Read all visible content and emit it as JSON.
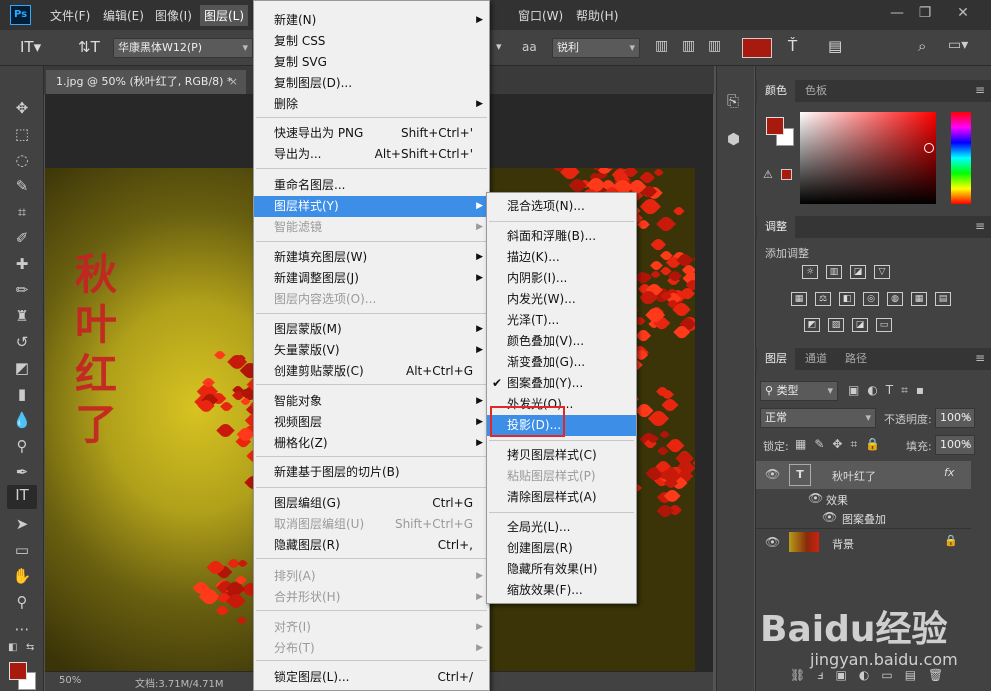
{
  "app": {
    "logo": "Ps"
  },
  "menubar": {
    "items": [
      "文件(F)",
      "编辑(E)",
      "图像(I)",
      "图层(L)",
      "窗口(W)",
      "帮助(H)"
    ]
  },
  "options": {
    "font_family": "华康黑体W12(P)",
    "aa_label": "aa",
    "anti_alias": "锐利",
    "text_color": "#a81a0e"
  },
  "document": {
    "tab_title": "1.jpg @ 50% (秋叶红了, RGB/8) *",
    "zoom": "50%",
    "doc_size": "文档:3.71M/4.71M",
    "text_layer_content": "秋叶红了"
  },
  "layer_menu": {
    "items": [
      {
        "label": "新建(N)",
        "shortcut": "",
        "arrow": true,
        "disabled": false
      },
      {
        "label": "复制 CSS",
        "shortcut": "",
        "arrow": false,
        "disabled": false
      },
      {
        "label": "复制 SVG",
        "shortcut": "",
        "arrow": false,
        "disabled": false
      },
      {
        "label": "复制图层(D)...",
        "shortcut": "",
        "arrow": false,
        "disabled": false
      },
      {
        "label": "删除",
        "shortcut": "",
        "arrow": true,
        "disabled": false
      },
      {
        "label": "快速导出为 PNG",
        "shortcut": "Shift+Ctrl+'",
        "arrow": false,
        "disabled": false
      },
      {
        "label": "导出为...",
        "shortcut": "Alt+Shift+Ctrl+'",
        "arrow": false,
        "disabled": false
      },
      {
        "label": "重命名图层...",
        "shortcut": "",
        "arrow": false,
        "disabled": false
      },
      {
        "label": "图层样式(Y)",
        "shortcut": "",
        "arrow": true,
        "disabled": false
      },
      {
        "label": "智能滤镜",
        "shortcut": "",
        "arrow": true,
        "disabled": true
      },
      {
        "label": "新建填充图层(W)",
        "shortcut": "",
        "arrow": true,
        "disabled": false
      },
      {
        "label": "新建调整图层(J)",
        "shortcut": "",
        "arrow": true,
        "disabled": false
      },
      {
        "label": "图层内容选项(O)...",
        "shortcut": "",
        "arrow": false,
        "disabled": true
      },
      {
        "label": "图层蒙版(M)",
        "shortcut": "",
        "arrow": true,
        "disabled": false
      },
      {
        "label": "矢量蒙版(V)",
        "shortcut": "",
        "arrow": true,
        "disabled": false
      },
      {
        "label": "创建剪贴蒙版(C)",
        "shortcut": "Alt+Ctrl+G",
        "arrow": false,
        "disabled": false
      },
      {
        "label": "智能对象",
        "shortcut": "",
        "arrow": true,
        "disabled": false
      },
      {
        "label": "视频图层",
        "shortcut": "",
        "arrow": true,
        "disabled": false
      },
      {
        "label": "栅格化(Z)",
        "shortcut": "",
        "arrow": true,
        "disabled": false
      },
      {
        "label": "新建基于图层的切片(B)",
        "shortcut": "",
        "arrow": false,
        "disabled": false
      },
      {
        "label": "图层编组(G)",
        "shortcut": "Ctrl+G",
        "arrow": false,
        "disabled": false
      },
      {
        "label": "取消图层编组(U)",
        "shortcut": "Shift+Ctrl+G",
        "arrow": false,
        "disabled": true
      },
      {
        "label": "隐藏图层(R)",
        "shortcut": "Ctrl+,",
        "arrow": false,
        "disabled": false
      },
      {
        "label": "排列(A)",
        "shortcut": "",
        "arrow": true,
        "disabled": true
      },
      {
        "label": "合并形状(H)",
        "shortcut": "",
        "arrow": true,
        "disabled": true
      },
      {
        "label": "对齐(I)",
        "shortcut": "",
        "arrow": true,
        "disabled": true
      },
      {
        "label": "分布(T)",
        "shortcut": "",
        "arrow": true,
        "disabled": true
      },
      {
        "label": "锁定图层(L)...",
        "shortcut": "Ctrl+/",
        "arrow": false,
        "disabled": false
      }
    ]
  },
  "style_submenu": {
    "items": [
      {
        "label": "混合选项(N)...",
        "checked": false,
        "disabled": false
      },
      {
        "label": "斜面和浮雕(B)...",
        "checked": false,
        "disabled": false
      },
      {
        "label": "描边(K)...",
        "checked": false,
        "disabled": false
      },
      {
        "label": "内阴影(I)...",
        "checked": false,
        "disabled": false
      },
      {
        "label": "内发光(W)...",
        "checked": false,
        "disabled": false
      },
      {
        "label": "光泽(T)...",
        "checked": false,
        "disabled": false
      },
      {
        "label": "颜色叠加(V)...",
        "checked": false,
        "disabled": false
      },
      {
        "label": "渐变叠加(G)...",
        "checked": false,
        "disabled": false
      },
      {
        "label": "图案叠加(Y)...",
        "checked": true,
        "disabled": false
      },
      {
        "label": "外发光(O)...",
        "checked": false,
        "disabled": false
      },
      {
        "label": "投影(D)...",
        "checked": false,
        "disabled": false
      },
      {
        "label": "拷贝图层样式(C)",
        "checked": false,
        "disabled": false
      },
      {
        "label": "粘贴图层样式(P)",
        "checked": false,
        "disabled": true
      },
      {
        "label": "清除图层样式(A)",
        "checked": false,
        "disabled": false
      },
      {
        "label": "全局光(L)...",
        "checked": false,
        "disabled": false
      },
      {
        "label": "创建图层(R)",
        "checked": false,
        "disabled": false
      },
      {
        "label": "隐藏所有效果(H)",
        "checked": false,
        "disabled": false
      },
      {
        "label": "缩放效果(F)...",
        "checked": false,
        "disabled": false
      }
    ]
  },
  "panels": {
    "color_tabs": [
      "颜色",
      "色板"
    ],
    "adjust_tab": "调整",
    "adjust_add": "添加调整",
    "layers_tabs": [
      "图层",
      "通道",
      "路径"
    ],
    "filter_type": "类型",
    "blend_mode": "正常",
    "opacity_label": "不透明度:",
    "opacity_value": "100%",
    "lock_label": "锁定:",
    "fill_label": "填充:",
    "fill_value": "100%",
    "foreground_color": "#a81a0e",
    "fx_badge": "fx",
    "text_thumb": "T"
  },
  "layers": [
    {
      "name": "秋叶红了",
      "type": "text"
    },
    {
      "name": "效果",
      "type": "effects"
    },
    {
      "name": "图案叠加",
      "type": "effect"
    },
    {
      "name": "背景",
      "type": "background"
    }
  ],
  "watermark": {
    "logo": "Baidu经验",
    "url": "jingyan.baidu.com"
  }
}
